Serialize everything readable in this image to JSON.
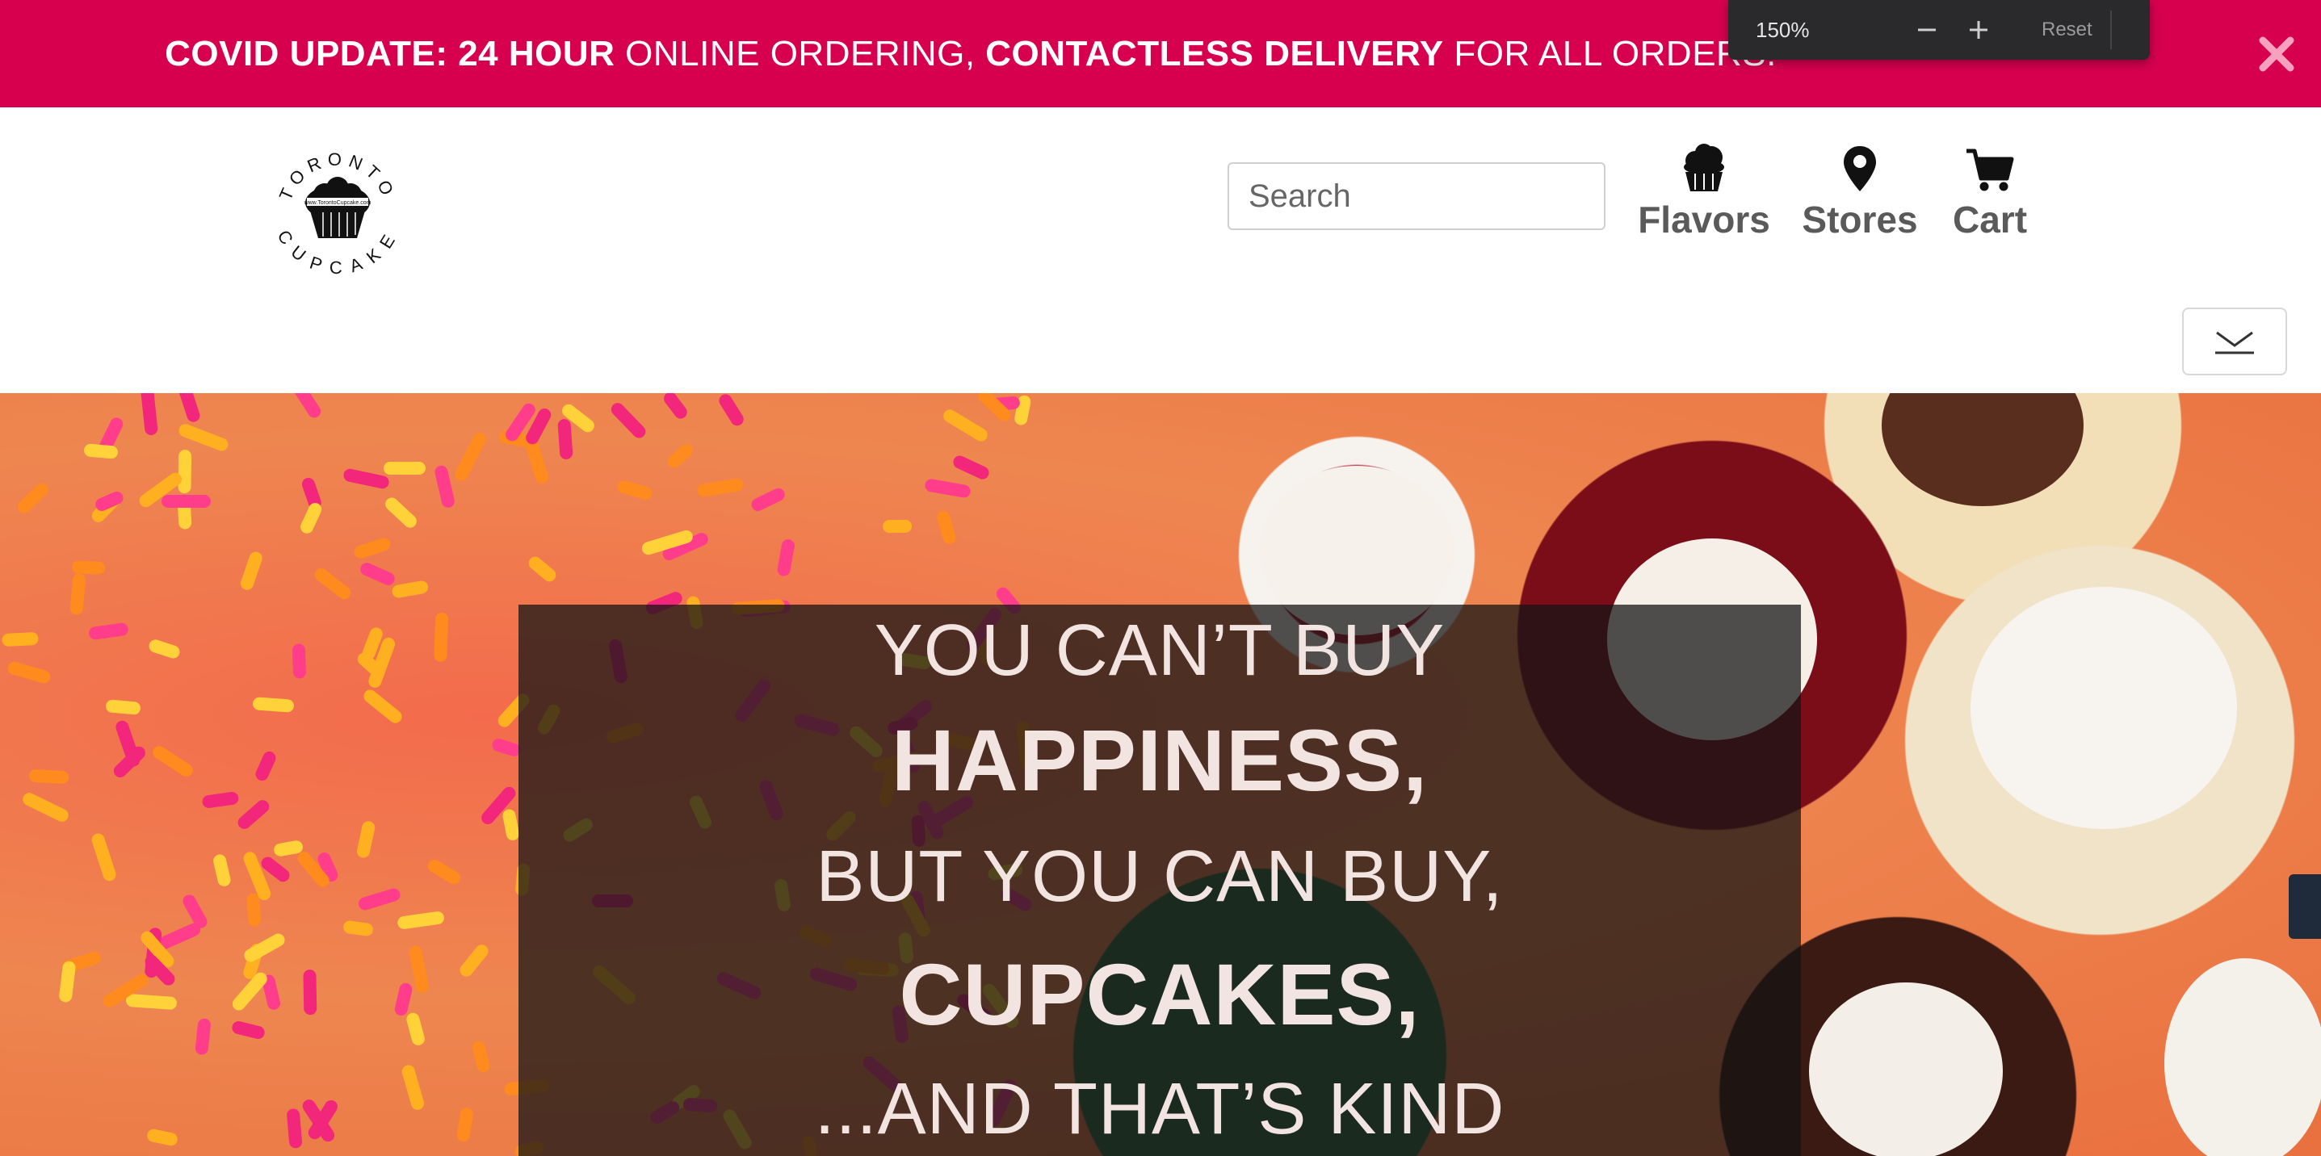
{
  "announcement": {
    "part1_bold": "COVID UPDATE: 24 HOUR",
    "part2": " ONLINE ORDERING, ",
    "part3_bold": "CONTACTLESS DELIVERY",
    "part4": " FOR ALL ORDERS.",
    "close_icon": "close-x-icon",
    "background": "#d6004f"
  },
  "zoom": {
    "level": "150%",
    "decrease_icon": "minus-icon",
    "increase_icon": "plus-icon",
    "reset_label": "Reset"
  },
  "header": {
    "logo_top_text": "TORONTO",
    "logo_bottom_text": "CUPCAKE",
    "logo_center_text": "www.TorontoCupcake.com",
    "search_placeholder": "Search",
    "nav": [
      {
        "label": "Flavors",
        "icon": "cupcake-icon"
      },
      {
        "label": "Stores",
        "icon": "map-pin-icon"
      },
      {
        "label": "Cart",
        "icon": "shopping-cart-icon"
      }
    ],
    "toggle_icon": "chevron-down-icon"
  },
  "hero": {
    "lines": [
      "YOU CAN’T BUY",
      "HAPPINESS,",
      "BUT YOU CAN BUY,",
      "CUPCAKES,",
      "...AND THAT’S KIND"
    ]
  }
}
